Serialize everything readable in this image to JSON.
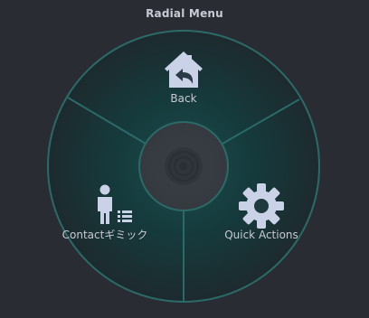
{
  "title": "Radial Menu",
  "items": [
    {
      "label": "Back",
      "icon": "home-back-icon"
    },
    {
      "label": "Quick Actions",
      "icon": "gear-icon"
    },
    {
      "label": "Contactギミック",
      "icon": "contact-list-icon"
    }
  ],
  "colors": {
    "background": "#2a2c33",
    "ring": "#2b6a68",
    "center": "#3a3f45",
    "icon": "#c9d2e6",
    "text": "#c6cad3"
  }
}
